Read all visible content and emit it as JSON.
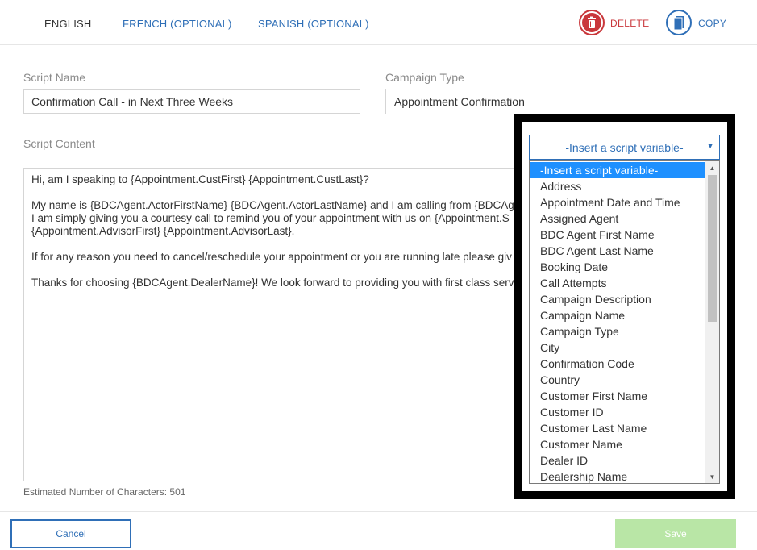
{
  "tabs": [
    {
      "label": "ENGLISH",
      "active": true
    },
    {
      "label": "FRENCH (OPTIONAL)",
      "active": false
    },
    {
      "label": "SPANISH (OPTIONAL)",
      "active": false
    }
  ],
  "actions": {
    "delete_label": "DELETE",
    "delete_icon": "trash-icon",
    "copy_label": "COPY",
    "copy_icon": "copy-icon"
  },
  "form": {
    "script_name_label": "Script Name",
    "script_name_value": "Confirmation Call - in Next Three Weeks",
    "campaign_type_label": "Campaign Type",
    "campaign_type_value": "Appointment Confirmation",
    "script_content_label": "Script Content",
    "script_lines": [
      "Hi, am I speaking to {Appointment.CustFirst} {Appointment.CustLast}?",
      "My name is {BDCAgent.ActorFirstName} {BDCAgent.ActorLastName} and I am calling from {BDCAgent",
      "I am simply giving you a courtesy call to remind you of your appointment with us on {Appointment.S",
      "{Appointment.AdvisorFirst} {Appointment.AdvisorLast}.",
      "If for any reason you need to cancel/reschedule your appointment or you are running late please giv",
      "Thanks for choosing {BDCAgent.DealerName}!  We look forward to providing you with first class serv"
    ],
    "char_count_text": "Estimated Number of Characters: 501"
  },
  "variable_select": {
    "selected": "-Insert a script variable-",
    "options": [
      "-Insert a script variable-",
      "Address",
      "Appointment Date and Time",
      "Assigned Agent",
      "BDC Agent First Name",
      "BDC Agent Last Name",
      "Booking Date",
      "Call Attempts",
      "Campaign Description",
      "Campaign Name",
      "Campaign Type",
      "City",
      "Confirmation Code",
      "Country",
      "Customer First Name",
      "Customer ID",
      "Customer Last Name",
      "Customer Name",
      "Dealer ID",
      "Dealership Name"
    ]
  },
  "buttons": {
    "cancel_label": "Cancel",
    "save_label": "Save"
  },
  "colors": {
    "accent": "#2f6fb7",
    "danger": "#c9373b",
    "save_disabled": "#b9e6a6",
    "selected_option": "#1e90ff"
  }
}
